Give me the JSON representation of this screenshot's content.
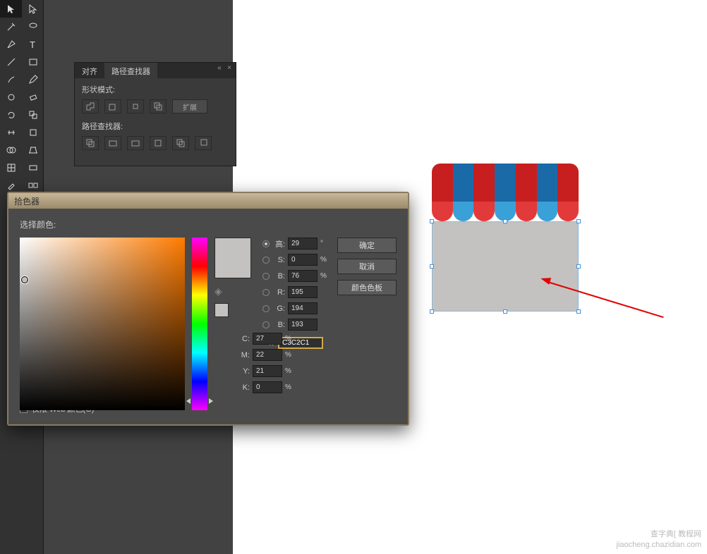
{
  "pathfinder_panel": {
    "tabs": {
      "align": "对齐",
      "pathfinder": "路径查找器"
    },
    "shape_modes_label": "形状模式:",
    "expand_label": "扩展",
    "pathfinders_label": "路径查找器:"
  },
  "color_picker": {
    "title": "拾色器",
    "select_label": "选择颜色:",
    "buttons": {
      "ok": "确定",
      "cancel": "取消",
      "swatches": "颜色色板"
    },
    "hsb": {
      "h": {
        "label": "高:",
        "value": "29",
        "unit": "°"
      },
      "s": {
        "label": "S:",
        "value": "0",
        "unit": "%"
      },
      "b": {
        "label": "B:",
        "value": "76",
        "unit": "%"
      }
    },
    "rgb": {
      "r": {
        "label": "R:",
        "value": "195"
      },
      "g": {
        "label": "G:",
        "value": "194"
      },
      "b": {
        "label": "B:",
        "value": "193"
      }
    },
    "cmyk": {
      "c": {
        "label": "C:",
        "value": "27",
        "unit": "%"
      },
      "m": {
        "label": "M:",
        "value": "22",
        "unit": "%"
      },
      "y": {
        "label": "Y:",
        "value": "21",
        "unit": "%"
      },
      "k": {
        "label": "K:",
        "value": "0",
        "unit": "%"
      }
    },
    "hex_prefix": "#",
    "hex": "C3C2C1",
    "web_only_label": "仅限 Web 颜色(O)"
  },
  "watermark": {
    "line1": "查字典[ 教程网",
    "line2": "jiaocheng.chazidian.com"
  }
}
